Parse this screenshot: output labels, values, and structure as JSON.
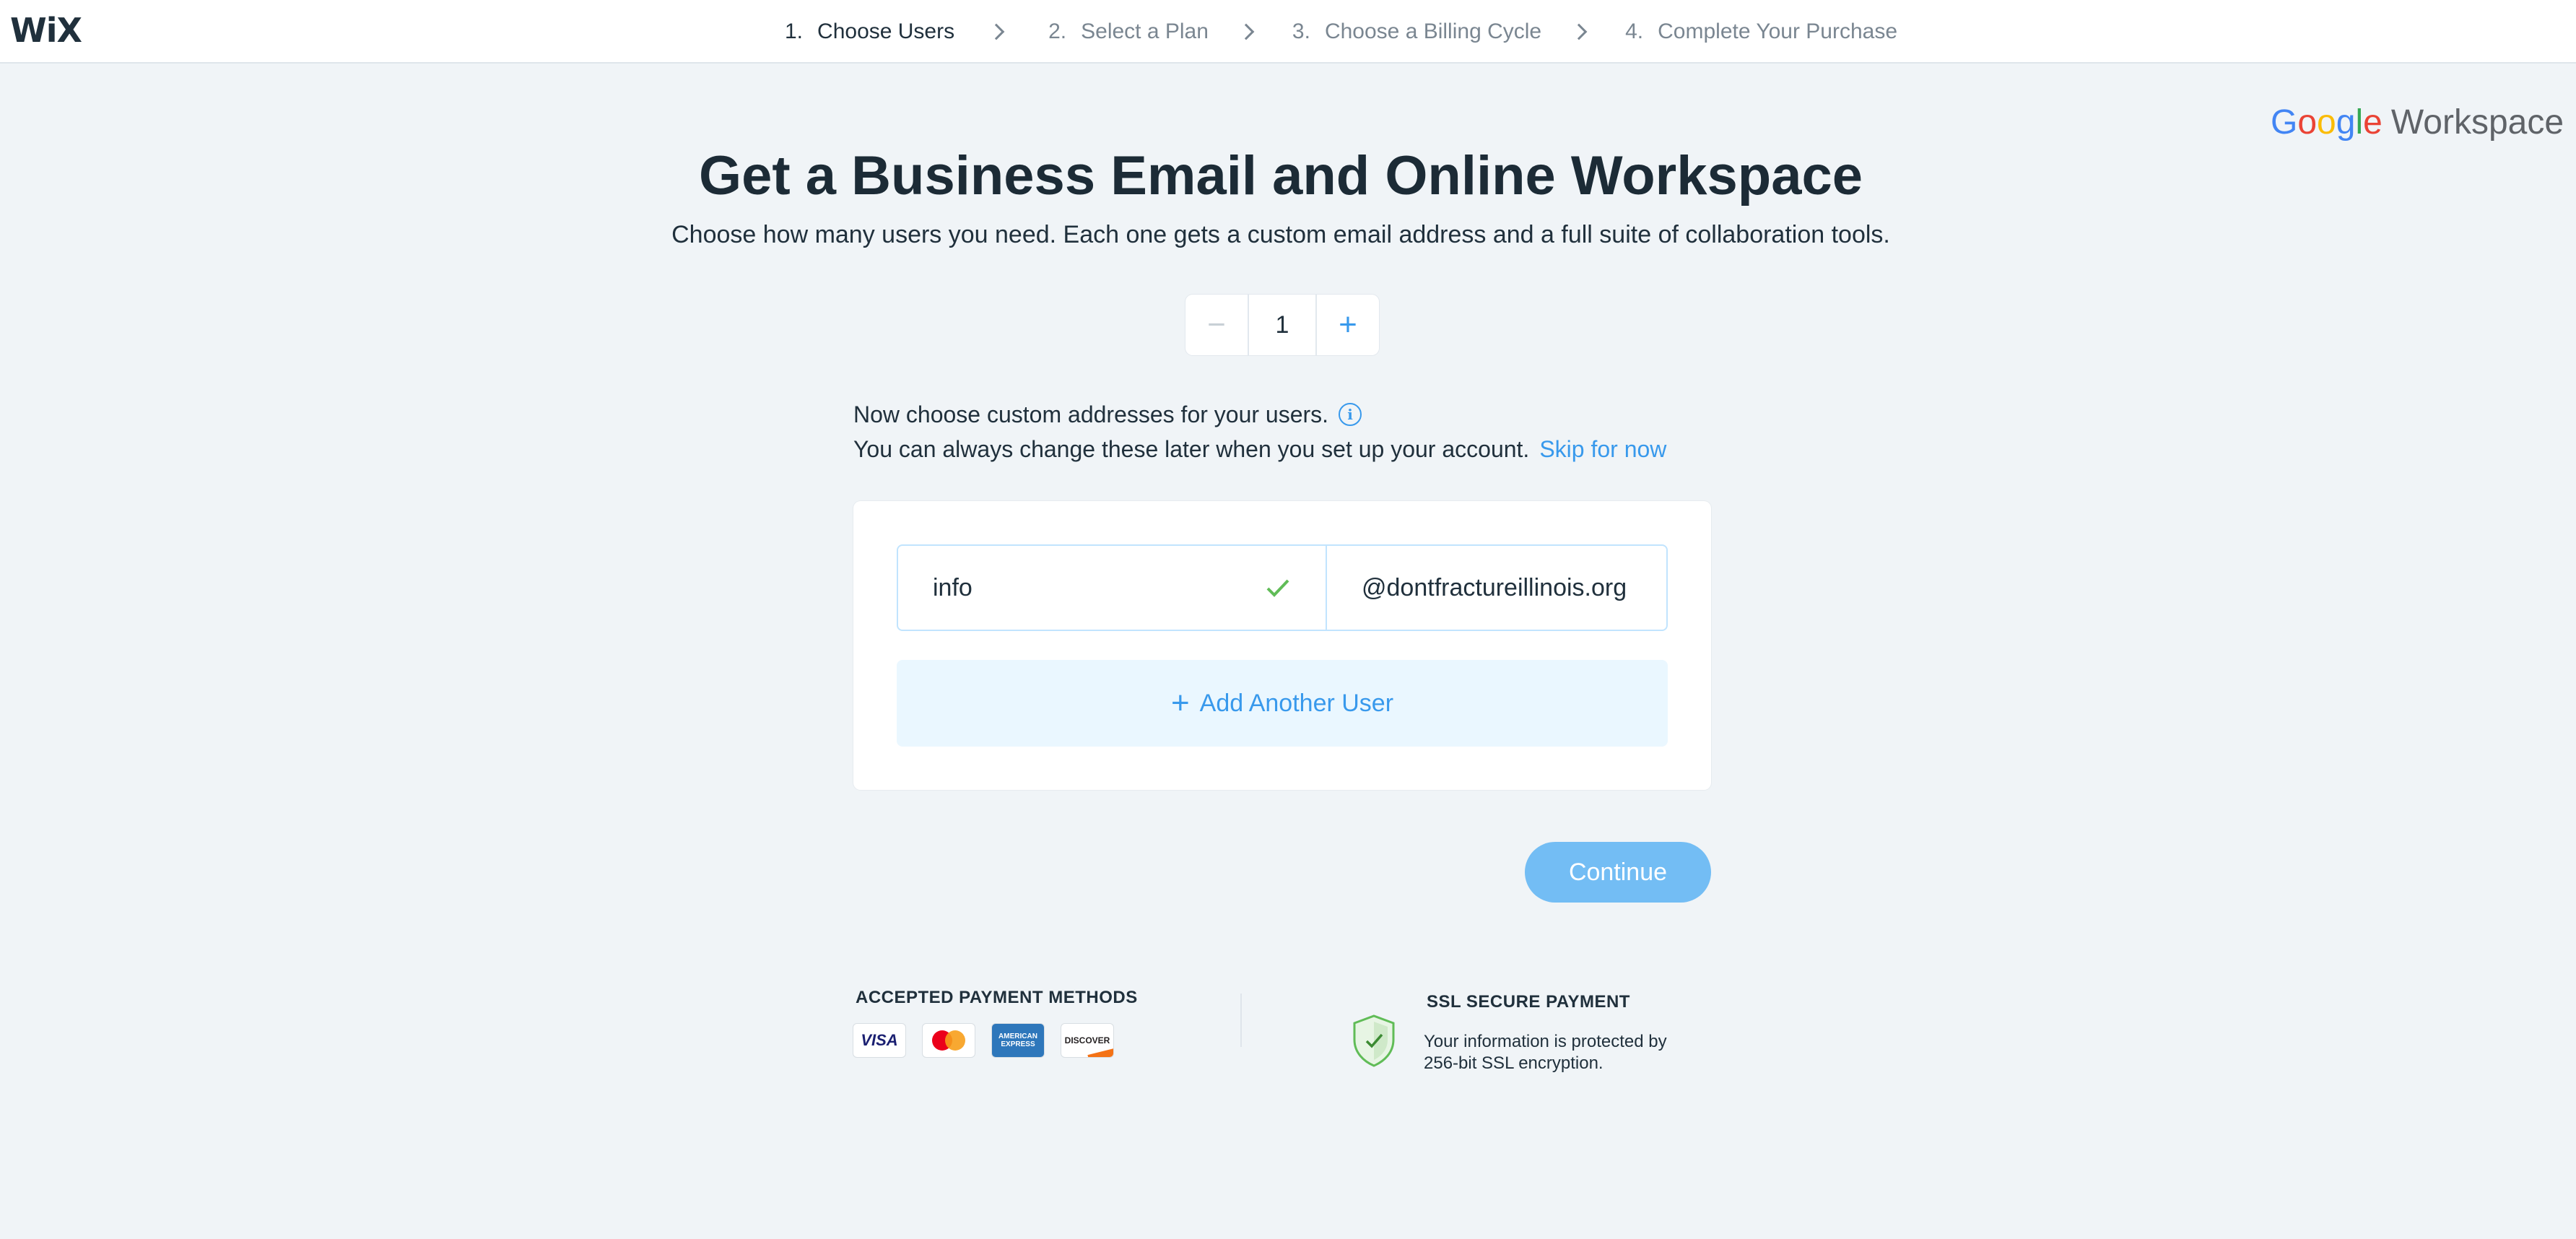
{
  "brand": {
    "logo_text": "WiX"
  },
  "steps": [
    {
      "number": "1.",
      "label": "Choose Users",
      "active": true
    },
    {
      "number": "2.",
      "label": "Select a Plan",
      "active": false
    },
    {
      "number": "3.",
      "label": "Choose a Billing Cycle",
      "active": false
    },
    {
      "number": "4.",
      "label": "Complete Your Purchase",
      "active": false
    }
  ],
  "partner_logo": {
    "google": "Google",
    "product": "Workspace"
  },
  "main": {
    "title": "Get a Business Email and Online Workspace",
    "subtitle": "Choose how many users you need. Each one gets a custom email address and a full suite of collaboration tools."
  },
  "user_count": {
    "value": "1",
    "decrement": "−",
    "increment": "+"
  },
  "instructions": {
    "line1": "Now choose custom addresses for your users.",
    "line2": "You can always change these later when you set up your account.",
    "skip_label": "Skip for now"
  },
  "email_form": {
    "local_value": "info",
    "domain": "@dontfractureillinois.org",
    "add_user_label": "Add Another User"
  },
  "continue_label": "Continue",
  "footer": {
    "payment_title": "ACCEPTED PAYMENT METHODS",
    "payment_cards": {
      "visa": "VISA",
      "amex": "AMERICAN EXPRESS",
      "discover": "DISCOVER"
    },
    "ssl_title": "SSL SECURE PAYMENT",
    "ssl_line1": "Your information is protected by",
    "ssl_line2": "256-bit SSL encryption."
  },
  "colors": {
    "accent": "#3899ec",
    "continue_bg": "#73bdf4",
    "valid_check": "#60bc57",
    "page_bg": "#f0f4f7"
  }
}
